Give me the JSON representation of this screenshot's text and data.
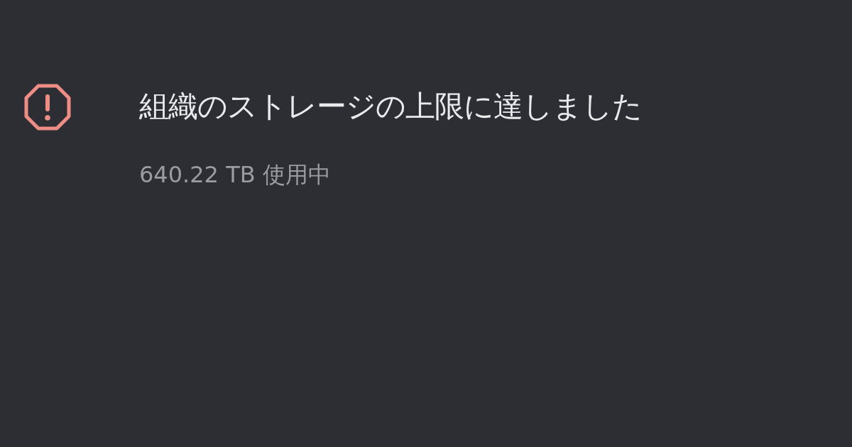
{
  "alert": {
    "kind": "error",
    "title": "組織のストレージの上限に達しました",
    "usage": "640.22 TB 使用中"
  }
}
